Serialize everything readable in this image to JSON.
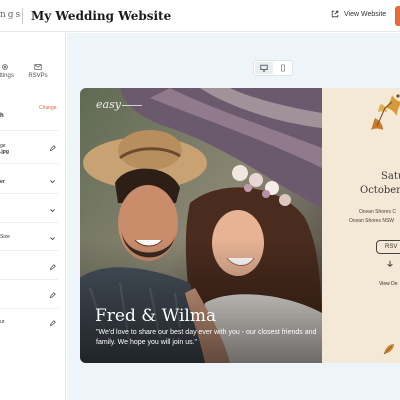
{
  "header": {
    "logo": "ngs",
    "site_title": "My Wedding Website",
    "view_website_label": "View Website"
  },
  "sidebar": {
    "nav": [
      {
        "label": "ettings",
        "icon": "gear-icon"
      },
      {
        "label": "RSVPs",
        "icon": "mail-icon"
      }
    ],
    "change_label": "Change",
    "section_heading": "h",
    "rows": [
      {
        "lines": [
          "ge",
          ".jpg"
        ],
        "control": "pencil-icon"
      },
      {
        "lines": [
          "er"
        ],
        "control": "chevron-down-icon"
      },
      {
        "lines": [
          ""
        ],
        "control": "chevron-down-icon"
      },
      {
        "lines": [
          "Size"
        ],
        "control": "chevron-down-icon"
      },
      {
        "lines": [
          ""
        ],
        "control": "pencil-icon"
      },
      {
        "lines": [
          ""
        ],
        "control": "pencil-icon"
      },
      {
        "lines": [
          "ur"
        ],
        "control": "pencil-icon"
      }
    ]
  },
  "preview": {
    "brand": "easy",
    "couple_names": "Fred & Wilma",
    "tagline": "\"We'd love to share our best day ever with you - our closest friends and family. We hope you will join us.\"",
    "date_line1": "Satur",
    "date_line2": "October r",
    "location_line1": "Ocean Shores C",
    "location_line2": "Ocean Shores NSW",
    "rsvp_label": "RSV",
    "view_details_label": "View De"
  },
  "colors": {
    "accent": "#e8683a",
    "main_bg": "#eef5f9",
    "card_bg": "#f3e9d6"
  }
}
